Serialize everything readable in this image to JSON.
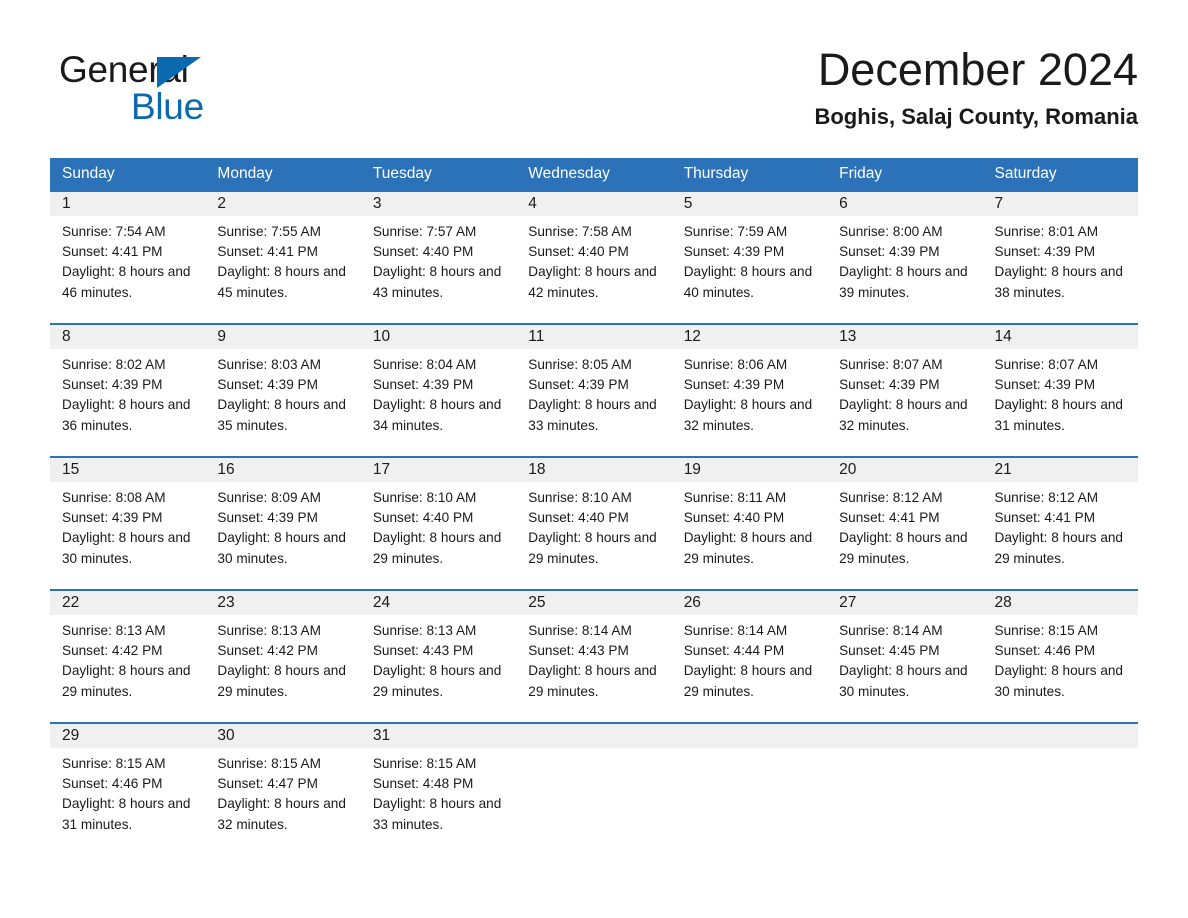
{
  "logo": {
    "word1": "General",
    "word2": "Blue",
    "triangle_color": "#0b69b0"
  },
  "header": {
    "title": "December 2024",
    "location": "Boghis, Salaj County, Romania"
  },
  "colors": {
    "header_blue": "#2b72b8",
    "row_divider_blue": "#2b72b8",
    "date_strip_gray": "#f0f0f0",
    "text": "#1a1a1a"
  },
  "weekdays": [
    "Sunday",
    "Monday",
    "Tuesday",
    "Wednesday",
    "Thursday",
    "Friday",
    "Saturday"
  ],
  "weeks": [
    [
      {
        "day": "1",
        "sunrise": "Sunrise: 7:54 AM",
        "sunset": "Sunset: 4:41 PM",
        "daylight": "Daylight: 8 hours and 46 minutes."
      },
      {
        "day": "2",
        "sunrise": "Sunrise: 7:55 AM",
        "sunset": "Sunset: 4:41 PM",
        "daylight": "Daylight: 8 hours and 45 minutes."
      },
      {
        "day": "3",
        "sunrise": "Sunrise: 7:57 AM",
        "sunset": "Sunset: 4:40 PM",
        "daylight": "Daylight: 8 hours and 43 minutes."
      },
      {
        "day": "4",
        "sunrise": "Sunrise: 7:58 AM",
        "sunset": "Sunset: 4:40 PM",
        "daylight": "Daylight: 8 hours and 42 minutes."
      },
      {
        "day": "5",
        "sunrise": "Sunrise: 7:59 AM",
        "sunset": "Sunset: 4:39 PM",
        "daylight": "Daylight: 8 hours and 40 minutes."
      },
      {
        "day": "6",
        "sunrise": "Sunrise: 8:00 AM",
        "sunset": "Sunset: 4:39 PM",
        "daylight": "Daylight: 8 hours and 39 minutes."
      },
      {
        "day": "7",
        "sunrise": "Sunrise: 8:01 AM",
        "sunset": "Sunset: 4:39 PM",
        "daylight": "Daylight: 8 hours and 38 minutes."
      }
    ],
    [
      {
        "day": "8",
        "sunrise": "Sunrise: 8:02 AM",
        "sunset": "Sunset: 4:39 PM",
        "daylight": "Daylight: 8 hours and 36 minutes."
      },
      {
        "day": "9",
        "sunrise": "Sunrise: 8:03 AM",
        "sunset": "Sunset: 4:39 PM",
        "daylight": "Daylight: 8 hours and 35 minutes."
      },
      {
        "day": "10",
        "sunrise": "Sunrise: 8:04 AM",
        "sunset": "Sunset: 4:39 PM",
        "daylight": "Daylight: 8 hours and 34 minutes."
      },
      {
        "day": "11",
        "sunrise": "Sunrise: 8:05 AM",
        "sunset": "Sunset: 4:39 PM",
        "daylight": "Daylight: 8 hours and 33 minutes."
      },
      {
        "day": "12",
        "sunrise": "Sunrise: 8:06 AM",
        "sunset": "Sunset: 4:39 PM",
        "daylight": "Daylight: 8 hours and 32 minutes."
      },
      {
        "day": "13",
        "sunrise": "Sunrise: 8:07 AM",
        "sunset": "Sunset: 4:39 PM",
        "daylight": "Daylight: 8 hours and 32 minutes."
      },
      {
        "day": "14",
        "sunrise": "Sunrise: 8:07 AM",
        "sunset": "Sunset: 4:39 PM",
        "daylight": "Daylight: 8 hours and 31 minutes."
      }
    ],
    [
      {
        "day": "15",
        "sunrise": "Sunrise: 8:08 AM",
        "sunset": "Sunset: 4:39 PM",
        "daylight": "Daylight: 8 hours and 30 minutes."
      },
      {
        "day": "16",
        "sunrise": "Sunrise: 8:09 AM",
        "sunset": "Sunset: 4:39 PM",
        "daylight": "Daylight: 8 hours and 30 minutes."
      },
      {
        "day": "17",
        "sunrise": "Sunrise: 8:10 AM",
        "sunset": "Sunset: 4:40 PM",
        "daylight": "Daylight: 8 hours and 29 minutes."
      },
      {
        "day": "18",
        "sunrise": "Sunrise: 8:10 AM",
        "sunset": "Sunset: 4:40 PM",
        "daylight": "Daylight: 8 hours and 29 minutes."
      },
      {
        "day": "19",
        "sunrise": "Sunrise: 8:11 AM",
        "sunset": "Sunset: 4:40 PM",
        "daylight": "Daylight: 8 hours and 29 minutes."
      },
      {
        "day": "20",
        "sunrise": "Sunrise: 8:12 AM",
        "sunset": "Sunset: 4:41 PM",
        "daylight": "Daylight: 8 hours and 29 minutes."
      },
      {
        "day": "21",
        "sunrise": "Sunrise: 8:12 AM",
        "sunset": "Sunset: 4:41 PM",
        "daylight": "Daylight: 8 hours and 29 minutes."
      }
    ],
    [
      {
        "day": "22",
        "sunrise": "Sunrise: 8:13 AM",
        "sunset": "Sunset: 4:42 PM",
        "daylight": "Daylight: 8 hours and 29 minutes."
      },
      {
        "day": "23",
        "sunrise": "Sunrise: 8:13 AM",
        "sunset": "Sunset: 4:42 PM",
        "daylight": "Daylight: 8 hours and 29 minutes."
      },
      {
        "day": "24",
        "sunrise": "Sunrise: 8:13 AM",
        "sunset": "Sunset: 4:43 PM",
        "daylight": "Daylight: 8 hours and 29 minutes."
      },
      {
        "day": "25",
        "sunrise": "Sunrise: 8:14 AM",
        "sunset": "Sunset: 4:43 PM",
        "daylight": "Daylight: 8 hours and 29 minutes."
      },
      {
        "day": "26",
        "sunrise": "Sunrise: 8:14 AM",
        "sunset": "Sunset: 4:44 PM",
        "daylight": "Daylight: 8 hours and 29 minutes."
      },
      {
        "day": "27",
        "sunrise": "Sunrise: 8:14 AM",
        "sunset": "Sunset: 4:45 PM",
        "daylight": "Daylight: 8 hours and 30 minutes."
      },
      {
        "day": "28",
        "sunrise": "Sunrise: 8:15 AM",
        "sunset": "Sunset: 4:46 PM",
        "daylight": "Daylight: 8 hours and 30 minutes."
      }
    ],
    [
      {
        "day": "29",
        "sunrise": "Sunrise: 8:15 AM",
        "sunset": "Sunset: 4:46 PM",
        "daylight": "Daylight: 8 hours and 31 minutes."
      },
      {
        "day": "30",
        "sunrise": "Sunrise: 8:15 AM",
        "sunset": "Sunset: 4:47 PM",
        "daylight": "Daylight: 8 hours and 32 minutes."
      },
      {
        "day": "31",
        "sunrise": "Sunrise: 8:15 AM",
        "sunset": "Sunset: 4:48 PM",
        "daylight": "Daylight: 8 hours and 33 minutes."
      },
      {
        "day": "",
        "sunrise": "",
        "sunset": "",
        "daylight": ""
      },
      {
        "day": "",
        "sunrise": "",
        "sunset": "",
        "daylight": ""
      },
      {
        "day": "",
        "sunrise": "",
        "sunset": "",
        "daylight": ""
      },
      {
        "day": "",
        "sunrise": "",
        "sunset": "",
        "daylight": ""
      }
    ]
  ]
}
